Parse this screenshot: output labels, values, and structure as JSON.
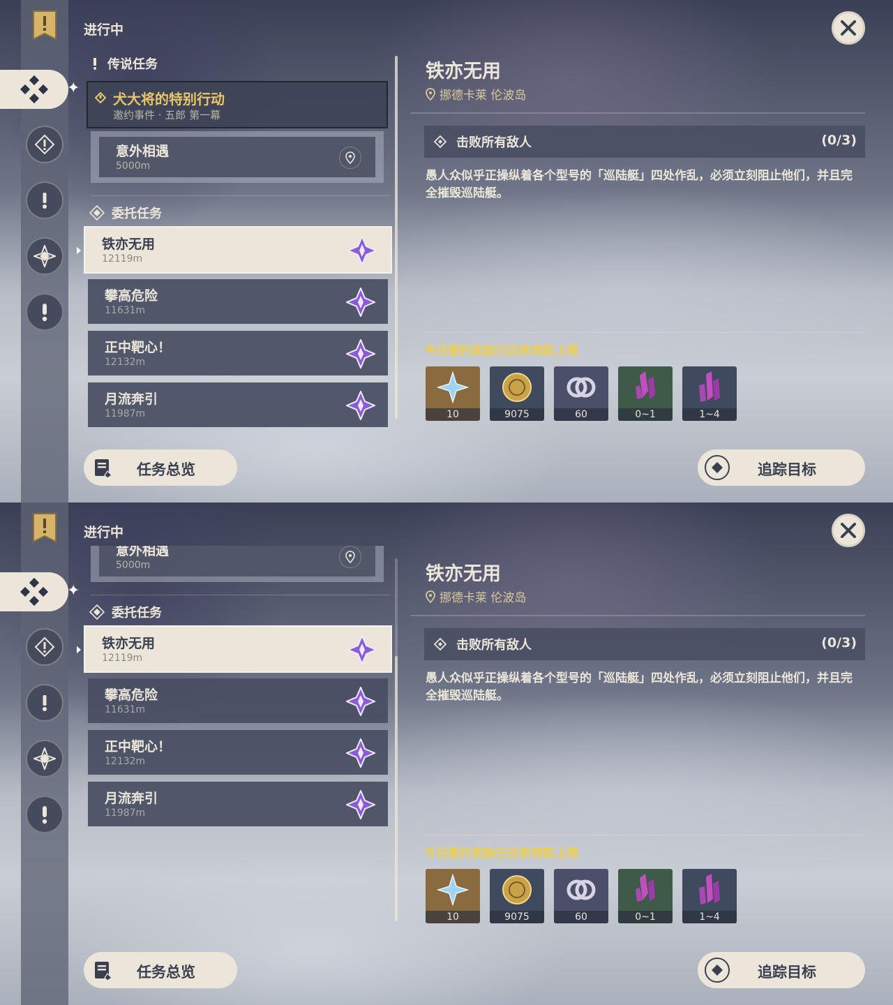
{
  "header": {
    "section_title": "进行中"
  },
  "categories": {
    "legend": "传说任务",
    "commission": "委托任务"
  },
  "legend_quest": {
    "title": "犬大将的特别行动",
    "subtitle": "邀约事件 · 五郎 第一幕",
    "sub_objective": {
      "title": "意外相遇",
      "distance": "5000m"
    }
  },
  "quests": [
    {
      "name": "铁亦无用",
      "distance": "12119m"
    },
    {
      "name": "攀高危险",
      "distance": "11631m"
    },
    {
      "name": "正中靶心！",
      "distance": "12132m"
    },
    {
      "name": "月流奔引",
      "distance": "11987m"
    }
  ],
  "detail": {
    "title": "铁亦无用",
    "location": "挪德卡莱 伦波岛",
    "objective": "击败所有敌人",
    "progress": "(0/3)",
    "description": "愚人众似乎正操纵着各个型号的「巡陆艇」四处作乱，必须立刻阻止他们，并且完全摧毁巡陆艇。",
    "reward_note": "今日委托奖励已达到领取上限",
    "rewards": [
      {
        "icon": "primogem-icon",
        "count": "10",
        "bg": "#8a6a3f"
      },
      {
        "icon": "mora-coin-icon",
        "count": "9075",
        "bg": "#3f4a5e"
      },
      {
        "icon": "friendship-exp-icon",
        "count": "60",
        "bg": "#4a4f6a"
      },
      {
        "icon": "crystal-icon",
        "count": "0~1",
        "bg": "#3f5a48"
      },
      {
        "icon": "crystal-cluster-icon",
        "count": "1~4",
        "bg": "#3f4a5e"
      }
    ]
  },
  "buttons": {
    "overview": "任务总览",
    "track": "追踪目标"
  },
  "colors": {
    "accent_gold": "#e9c46a",
    "cream": "#ece6da",
    "reward_note": "#f0cf4a",
    "commission_star": "#8a5cd8"
  }
}
